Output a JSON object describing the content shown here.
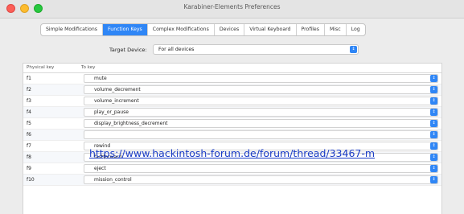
{
  "window": {
    "title": "Karabiner-Elements Preferences"
  },
  "tabs": [
    {
      "label": "Simple Modifications"
    },
    {
      "label": "Function Keys"
    },
    {
      "label": "Complex Modifications"
    },
    {
      "label": "Devices"
    },
    {
      "label": "Virtual Keyboard"
    },
    {
      "label": "Profiles"
    },
    {
      "label": "Misc"
    },
    {
      "label": "Log"
    }
  ],
  "active_tab": "Function Keys",
  "target_device": {
    "label": "Target Device:",
    "value": "For all devices"
  },
  "table": {
    "headers": {
      "physical_key": "Physical key",
      "to_key": "To key"
    },
    "rows": [
      {
        "key": "f1",
        "value": "mute"
      },
      {
        "key": "f2",
        "value": "volume_decrement"
      },
      {
        "key": "f3",
        "value": "volume_increment"
      },
      {
        "key": "f4",
        "value": "play_or_pause"
      },
      {
        "key": "f5",
        "value": "display_brightness_decrement"
      },
      {
        "key": "f6",
        "value": ""
      },
      {
        "key": "f7",
        "value": "rewind"
      },
      {
        "key": "f8",
        "value": "fastforward"
      },
      {
        "key": "f9",
        "value": "eject"
      },
      {
        "key": "f10",
        "value": "mission_control"
      }
    ]
  },
  "watermark": {
    "text": "https://www.hackintosh-forum.de/forum/thread/33467-m"
  },
  "colors": {
    "accent": "#2f86f6",
    "link": "#1a3cc6"
  }
}
